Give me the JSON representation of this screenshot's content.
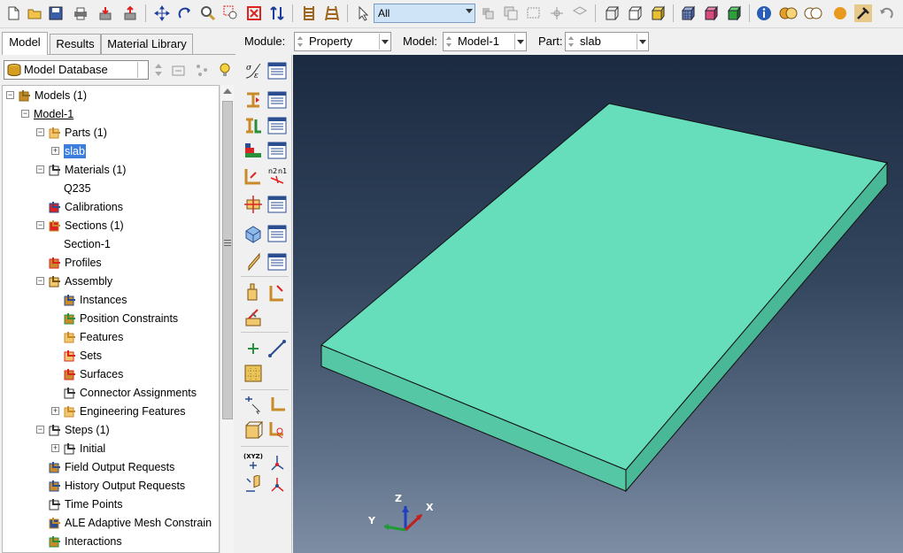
{
  "toolbar": {
    "selection_filter": "All",
    "icons": [
      "new-file-icon",
      "open-file-icon",
      "save-icon",
      "print-icon",
      "import-icon",
      "export-icon",
      "pan-icon",
      "rotate-icon",
      "zoom-icon",
      "box-zoom-icon",
      "auto-fit-icon",
      "cycle-views-icon",
      "ruler-icon",
      "select-arrow-icon",
      "wireframe-icon",
      "hidden-line-icon",
      "shaded-icon",
      "query-info-icon",
      "boolean-icon",
      "color-code-icon",
      "undo-icon"
    ]
  },
  "tabs": [
    "Model",
    "Results",
    "Material Library"
  ],
  "model_database": {
    "label": "Model Database"
  },
  "tree": [
    {
      "label": "Models (1)",
      "level": 0,
      "expander": "minus",
      "icon": "models-icon"
    },
    {
      "label": "Model-1",
      "level": 1,
      "expander": "minus",
      "icon": "",
      "underline": true
    },
    {
      "label": "Parts (1)",
      "level": 2,
      "expander": "minus",
      "icon": "parts-icon"
    },
    {
      "label": "slab",
      "level": 3,
      "expander": "plus",
      "icon": "",
      "selected": true
    },
    {
      "label": "Materials (1)",
      "level": 2,
      "expander": "minus",
      "icon": "materials-icon"
    },
    {
      "label": "Q235",
      "level": 3,
      "expander": "",
      "icon": ""
    },
    {
      "label": "Calibrations",
      "level": 2,
      "expander": "",
      "icon": "calibrations-icon"
    },
    {
      "label": "Sections (1)",
      "level": 2,
      "expander": "minus",
      "icon": "sections-icon"
    },
    {
      "label": "Section-1",
      "level": 3,
      "expander": "",
      "icon": ""
    },
    {
      "label": "Profiles",
      "level": 2,
      "expander": "",
      "icon": "profiles-icon"
    },
    {
      "label": "Assembly",
      "level": 2,
      "expander": "minus",
      "icon": "assembly-icon"
    },
    {
      "label": "Instances",
      "level": 3,
      "expander": "",
      "icon": "instances-icon"
    },
    {
      "label": "Position Constraints",
      "level": 3,
      "expander": "",
      "icon": "position-constraints-icon"
    },
    {
      "label": "Features",
      "level": 3,
      "expander": "",
      "icon": "features-icon"
    },
    {
      "label": "Sets",
      "level": 3,
      "expander": "",
      "icon": "sets-icon"
    },
    {
      "label": "Surfaces",
      "level": 3,
      "expander": "",
      "icon": "surfaces-icon"
    },
    {
      "label": "Connector Assignments",
      "level": 3,
      "expander": "",
      "icon": "connector-icon"
    },
    {
      "label": "Engineering Features",
      "level": 3,
      "expander": "plus",
      "icon": "engineering-icon"
    },
    {
      "label": "Steps (1)",
      "level": 2,
      "expander": "minus",
      "icon": "steps-icon"
    },
    {
      "label": "Initial",
      "level": 3,
      "expander": "plus",
      "icon": "initial-step-icon"
    },
    {
      "label": "Field Output Requests",
      "level": 2,
      "expander": "",
      "icon": "field-output-icon"
    },
    {
      "label": "History Output Requests",
      "level": 2,
      "expander": "",
      "icon": "history-output-icon"
    },
    {
      "label": "Time Points",
      "level": 2,
      "expander": "",
      "icon": "time-points-icon"
    },
    {
      "label": "ALE Adaptive Mesh Constrain",
      "level": 2,
      "expander": "",
      "icon": "ale-icon"
    },
    {
      "label": "Interactions",
      "level": 2,
      "expander": "",
      "icon": "interactions-icon"
    }
  ],
  "context": {
    "module_label": "Module:",
    "module_value": "Property",
    "model_label": "Model:",
    "model_value": "Model-1",
    "part_label": "Part:",
    "part_value": "slab"
  },
  "viewport": {
    "slab_top_color": "#66ddbb",
    "slab_side_color": "#55c7a5",
    "triad": {
      "x": "X",
      "y": "Y",
      "z": "Z"
    }
  }
}
